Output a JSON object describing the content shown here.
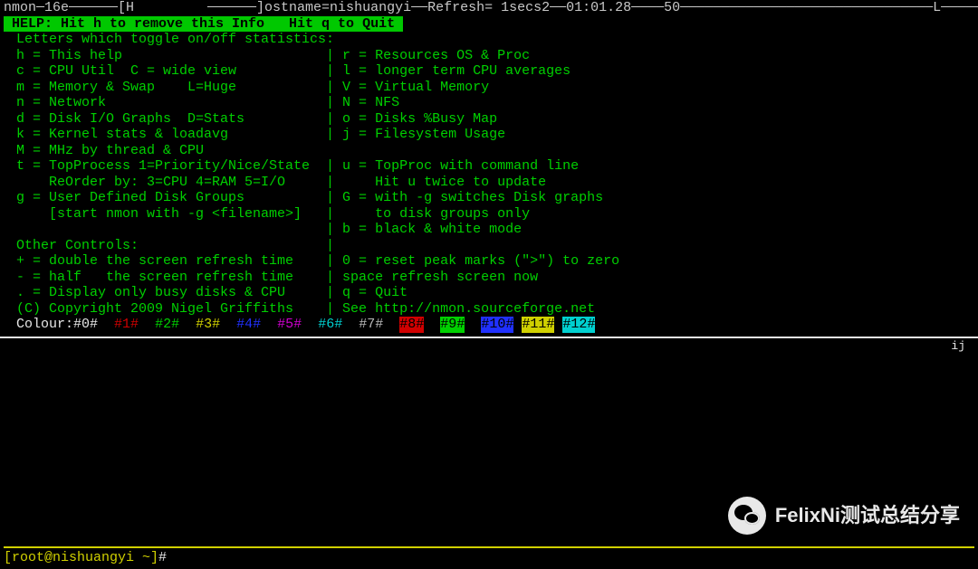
{
  "topbar": "nmon─16e──────[H         ──────]ostname=nishuangyi──Refresh= 1secs2──01:01.28────50───────────────────────────────L──────",
  "helpbar": " HELP: Hit h to remove this Info   Hit q to Quit ",
  "lines": {
    "l01": "Letters which toggle on/off statistics:",
    "l02": "h = This help                         | r = Resources OS & Proc",
    "l03": "c = CPU Util  C = wide view           | l = longer term CPU averages",
    "l04": "m = Memory & Swap    L=Huge           | V = Virtual Memory",
    "l05": "n = Network                           | N = NFS",
    "l06": "d = Disk I/O Graphs  D=Stats          | o = Disks %Busy Map",
    "l07": "k = Kernel stats & loadavg            | j = Filesystem Usage",
    "l08": "M = MHz by thread & CPU",
    "l09": "t = TopProcess 1=Priority/Nice/State  | u = TopProc with command line",
    "l10": "    ReOrder by: 3=CPU 4=RAM 5=I/O     |     Hit u twice to update",
    "l11": "g = User Defined Disk Groups          | G = with -g switches Disk graphs",
    "l12": "    [start nmon with -g <filename>]   |     to disk groups only",
    "l13": "                                      | b = black & white mode",
    "l14": "Other Controls:                       |",
    "l15": "+ = double the screen refresh time    | 0 = reset peak marks (\">\") to zero",
    "l16": "- = half   the screen refresh time    | space refresh screen now",
    "l17": ". = Display only busy disks & CPU     | q = Quit",
    "l18": "",
    "l19": "(C) Copyright 2009 Nigel Griffiths    | See http://nmon.sourceforge.net"
  },
  "colour": {
    "label": "Colour:",
    "c0": "#0#",
    "c1": "#1#",
    "c2": "#2#",
    "c3": "#3#",
    "c4": "#4#",
    "c5": "#5#",
    "c6": "#6#",
    "c7": "#7#",
    "c8": "#8#",
    "c9": "#9#",
    "c10": "#10#",
    "c11": "#11#",
    "c12": "#12#"
  },
  "hr_tail": "ij",
  "prompt": {
    "text": "[root@nishuangyi ~]",
    "hash": "#"
  },
  "watermark": "FelixNi测试总结分享"
}
